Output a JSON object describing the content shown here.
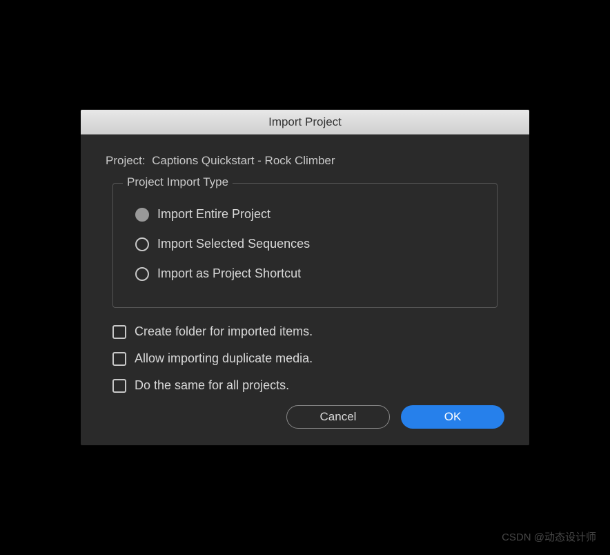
{
  "dialog": {
    "title": "Import Project",
    "project_label": "Project:",
    "project_name": "Captions Quickstart - Rock Climber",
    "import_type": {
      "legend": "Project Import Type",
      "options": [
        {
          "label": "Import Entire Project",
          "selected": true
        },
        {
          "label": "Import Selected Sequences",
          "selected": false
        },
        {
          "label": "Import as Project Shortcut",
          "selected": false
        }
      ]
    },
    "checkboxes": [
      {
        "label": "Create folder for imported items.",
        "checked": false
      },
      {
        "label": "Allow importing duplicate media.",
        "checked": false
      },
      {
        "label": "Do the same for all projects.",
        "checked": false
      }
    ],
    "buttons": {
      "cancel": "Cancel",
      "ok": "OK"
    }
  },
  "watermark": "CSDN @动态设计师"
}
